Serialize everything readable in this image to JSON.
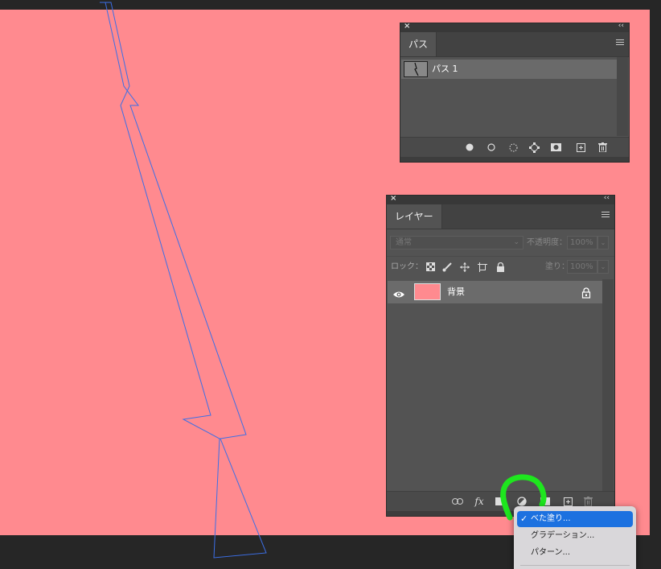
{
  "document": {
    "canvas_color": "#ff8a8f",
    "path_outline_color": "#3c6fe6"
  },
  "paths_panel": {
    "tab_label": "パス",
    "items": [
      {
        "name": "パス 1"
      }
    ],
    "footer_icons": [
      "fill-path-icon",
      "stroke-path-icon",
      "load-selection-icon",
      "make-work-path-icon",
      "add-mask-icon",
      "new-path-icon",
      "delete-icon"
    ]
  },
  "layers_panel": {
    "tab_label": "レイヤー",
    "blend_mode": "通常",
    "opacity_label": "不透明度：",
    "opacity_value": "100%",
    "lock_label": "ロック：",
    "fill_label": "塗り：",
    "fill_value": "100%",
    "layers": [
      {
        "name": "背景",
        "visible": true,
        "locked": true,
        "thumb_color": "#ff8a8f"
      }
    ],
    "footer_icons": [
      "link-icon",
      "fx-icon",
      "mask-icon",
      "adjustment-layer-icon",
      "group-icon",
      "new-layer-icon",
      "delete-icon"
    ],
    "fx_label": "fx"
  },
  "adjustment_menu": {
    "items": [
      {
        "label": "べた塗り...",
        "selected": true
      },
      {
        "label": "グラデーション...",
        "selected": false
      },
      {
        "label": "パターン...",
        "selected": false
      }
    ],
    "accent": "#1c71e0"
  },
  "annotation": {
    "highlight_color": "#1ee61e"
  }
}
